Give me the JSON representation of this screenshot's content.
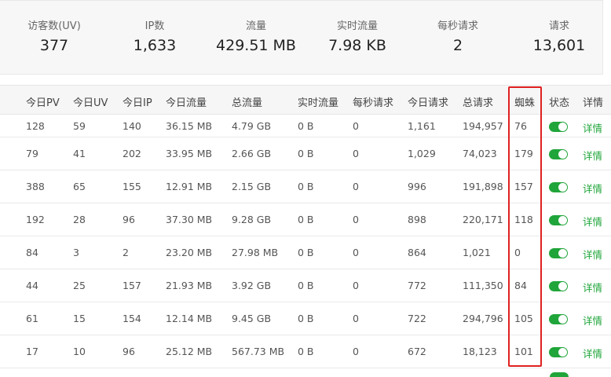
{
  "stats": [
    {
      "label": "访客数(UV)",
      "value": "377"
    },
    {
      "label": "IP数",
      "value": "1,633"
    },
    {
      "label": "流量",
      "value": "429.51 MB"
    },
    {
      "label": "实时流量",
      "value": "7.98 KB"
    },
    {
      "label": "每秒请求",
      "value": "2"
    },
    {
      "label": "请求",
      "value": "13,601"
    }
  ],
  "table": {
    "headers": [
      "今日PV",
      "今日UV",
      "今日IP",
      "今日流量",
      "总流量",
      "实时流量",
      "每秒请求",
      "今日请求",
      "总请求",
      "蜘蛛",
      "状态",
      "详情"
    ],
    "detail_label": "详情",
    "rows": [
      {
        "pv": "128",
        "uv": "59",
        "ip": "140",
        "today_traffic": "36.15 MB",
        "total_traffic": "4.79 GB",
        "realtime": "0 B",
        "qps": "0",
        "today_req": "1,161",
        "total_req": "194,957",
        "spider": "76",
        "enabled": true
      },
      {
        "pv": "79",
        "uv": "41",
        "ip": "202",
        "today_traffic": "33.95 MB",
        "total_traffic": "2.66 GB",
        "realtime": "0 B",
        "qps": "0",
        "today_req": "1,029",
        "total_req": "74,023",
        "spider": "179",
        "enabled": true
      },
      {
        "pv": "388",
        "uv": "65",
        "ip": "155",
        "today_traffic": "12.91 MB",
        "total_traffic": "2.15 GB",
        "realtime": "0 B",
        "qps": "0",
        "today_req": "996",
        "total_req": "191,898",
        "spider": "157",
        "enabled": true
      },
      {
        "pv": "192",
        "uv": "28",
        "ip": "96",
        "today_traffic": "37.30 MB",
        "total_traffic": "9.28 GB",
        "realtime": "0 B",
        "qps": "0",
        "today_req": "898",
        "total_req": "220,171",
        "spider": "118",
        "enabled": true
      },
      {
        "pv": "84",
        "uv": "3",
        "ip": "2",
        "today_traffic": "23.20 MB",
        "total_traffic": "27.98 MB",
        "realtime": "0 B",
        "qps": "0",
        "today_req": "864",
        "total_req": "1,021",
        "spider": "0",
        "enabled": true
      },
      {
        "pv": "44",
        "uv": "25",
        "ip": "157",
        "today_traffic": "21.93 MB",
        "total_traffic": "3.92 GB",
        "realtime": "0 B",
        "qps": "0",
        "today_req": "772",
        "total_req": "111,350",
        "spider": "84",
        "enabled": true
      },
      {
        "pv": "61",
        "uv": "15",
        "ip": "154",
        "today_traffic": "12.14 MB",
        "total_traffic": "9.45 GB",
        "realtime": "0 B",
        "qps": "0",
        "today_req": "722",
        "total_req": "294,796",
        "spider": "105",
        "enabled": true
      },
      {
        "pv": "17",
        "uv": "10",
        "ip": "96",
        "today_traffic": "25.12 MB",
        "total_traffic": "567.73 MB",
        "realtime": "0 B",
        "qps": "0",
        "today_req": "672",
        "total_req": "18,123",
        "spider": "101",
        "enabled": true
      }
    ]
  },
  "colors": {
    "accent": "#20a53a",
    "highlight": "#e02020"
  }
}
